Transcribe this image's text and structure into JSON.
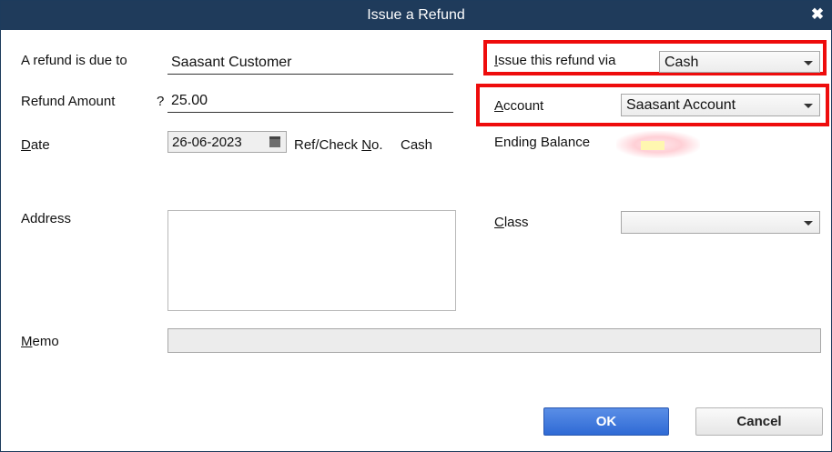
{
  "window": {
    "title": "Issue a Refund",
    "close_icon": "close-icon"
  },
  "form": {
    "refund_due_to_label": "A refund is due to",
    "refund_due_to_value": "Saasant Customer",
    "refund_amount_label": "Refund Amount",
    "currency_symbol": "?",
    "refund_amount_value": "25.00",
    "date_label": "Date",
    "date_value": "26-06-2023",
    "ref_check_label": "Ref/Check No.",
    "ref_check_value": "Cash",
    "address_label": "Address",
    "address_value": "",
    "memo_label": "Memo",
    "memo_value": "",
    "issue_via_label": "Issue this refund via",
    "issue_via_value": "Cash",
    "account_label": "Account",
    "account_value": "Saasant Account",
    "ending_balance_label": "Ending Balance",
    "class_label": "Class",
    "class_value": ""
  },
  "buttons": {
    "ok_label": "OK",
    "cancel_label": "Cancel"
  },
  "colors": {
    "titlebar": "#1f3b5b",
    "highlight": "#ee0c0c",
    "ok_button": "#2f6ad5"
  }
}
